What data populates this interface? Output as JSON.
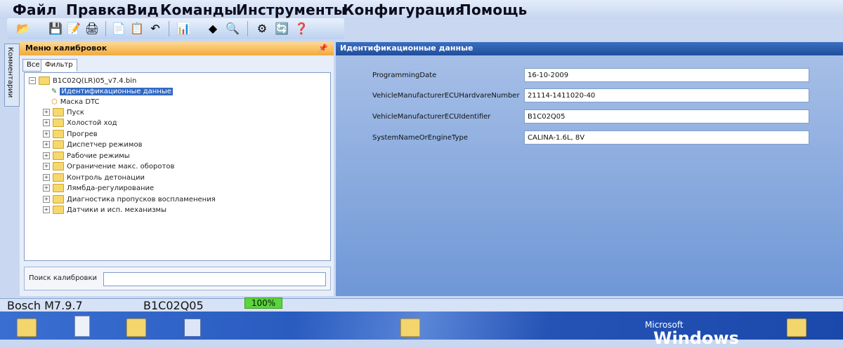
{
  "menu": [
    "Файл",
    "Правка",
    "Вид",
    "Команды",
    "Инструменты",
    "Конфигурация",
    "Помощь"
  ],
  "toolbar_icons": [
    "open-icon",
    "save-icon",
    "save-as-icon",
    "print-icon",
    "copy-icon",
    "paste-icon",
    "undo-icon",
    "chart-icon",
    "diamond-icon",
    "zoom-icon",
    "tools-icon",
    "network-icon",
    "help-icon"
  ],
  "left_side_tab": "Комментарии",
  "calibration_menu": {
    "title": "Меню калибровок",
    "tabs": [
      "Все",
      "Фильтр"
    ],
    "root": "B1C02Q(LR)05_v7.4.bin",
    "selected_item": "Идентификационные данные",
    "mask_item": "Маска DTC",
    "items": [
      "Пуск",
      "Холостой ход",
      "Прогрев",
      "Диспетчер режимов",
      "Рабочие режимы",
      "Ограничение макс. оборотов",
      "Контроль детонации",
      "Лямбда-регулирование",
      "Диагностика пропусков воспламенения",
      "Датчики и исп. механизмы"
    ],
    "search_label": "Поиск калибровки"
  },
  "identification": {
    "title": "Идентификационные данные",
    "fields": [
      {
        "label": "ProgrammingDate",
        "value": "16-10-2009"
      },
      {
        "label": "VehicleManufacturerECUHardvareNumber",
        "value": "21114-1411020-40"
      },
      {
        "label": "VehicleManufacturerECUIdentifier",
        "value": "B1C02Q05"
      },
      {
        "label": "SystemNameOrEngineType",
        "value": "CALINA-1.6L, 8V"
      }
    ]
  },
  "status": {
    "ecu": "Bosch M7.9.7",
    "id": "B1C02Q05",
    "progress": "100%",
    "progress_value": 100
  },
  "desktop": {
    "brand_small": "Microsoft",
    "brand_large": "Windows"
  }
}
